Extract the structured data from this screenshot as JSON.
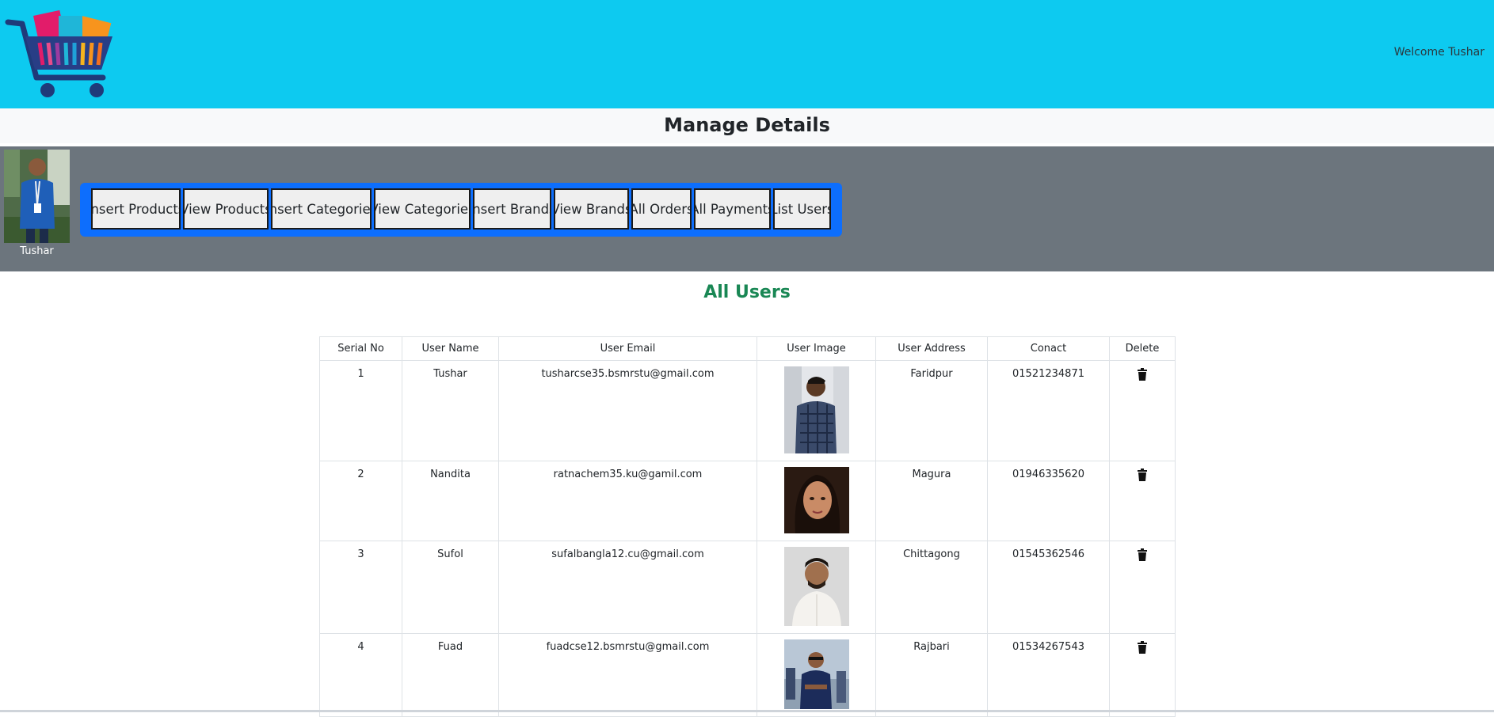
{
  "header": {
    "welcome": "Welcome Tushar",
    "logo_icon": "shopping-cart-logo",
    "bg_color": "#0dcaf0"
  },
  "page": {
    "title": "Manage Details"
  },
  "admin": {
    "name": "Tushar"
  },
  "nav": {
    "buttons": [
      "Insert Products",
      "View Products",
      "Insert Categories",
      "View Categories",
      "Insert Brands",
      "View Brands",
      "All Orders",
      "All Payments",
      "List Users"
    ],
    "accent": "#0d6efd"
  },
  "users": {
    "heading": "All Users",
    "heading_color": "#198754",
    "columns": [
      "Serial No",
      "User Name",
      "User Email",
      "User Image",
      "User Address",
      "Conact",
      "Delete"
    ],
    "rows": [
      {
        "serial": "1",
        "name": "Tushar",
        "email": "tusharcse35.bsmrstu@gmail.com",
        "address": "Faridpur",
        "contact": "01521234871",
        "delete_icon": "trash-icon"
      },
      {
        "serial": "2",
        "name": "Nandita",
        "email": "ratnachem35.ku@gamil.com",
        "address": "Magura",
        "contact": "01946335620",
        "delete_icon": "trash-icon"
      },
      {
        "serial": "3",
        "name": "Sufol",
        "email": "sufalbangla12.cu@gmail.com",
        "address": "Chittagong",
        "contact": "01545362546",
        "delete_icon": "trash-icon"
      },
      {
        "serial": "4",
        "name": "Fuad",
        "email": "fuadcse12.bsmrstu@gmail.com",
        "address": "Rajbari",
        "contact": "01534267543",
        "delete_icon": "trash-icon"
      }
    ]
  }
}
